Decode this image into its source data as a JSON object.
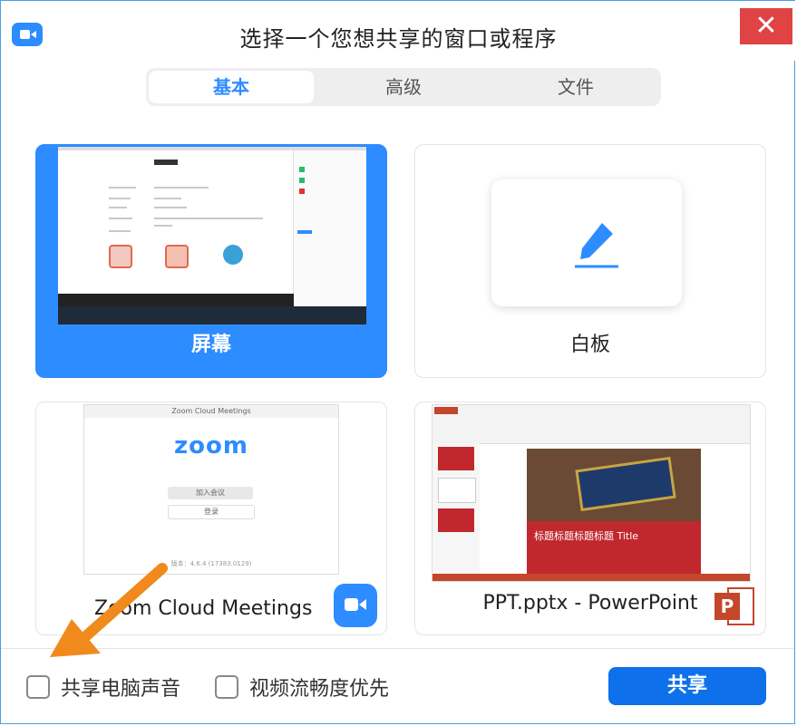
{
  "window": {
    "title": "选择一个您想共享的窗口或程序",
    "close_glyph": "✕"
  },
  "tabs": [
    {
      "label": "基本",
      "active": true
    },
    {
      "label": "高级",
      "active": false
    },
    {
      "label": "文件",
      "active": false
    }
  ],
  "cards": [
    {
      "label": "屏幕",
      "selected": true
    },
    {
      "label": "白板",
      "selected": false
    },
    {
      "label": "Zoom Cloud Meetings",
      "selected": false
    },
    {
      "label": "PPT.pptx - PowerPoint",
      "selected": false
    }
  ],
  "zoom_thumb": {
    "window_title": "Zoom Cloud Meetings",
    "logo": "zoom",
    "join_button": "加入会议",
    "login_button": "登录",
    "footer": "版本：4.6.4 (17383.0129)"
  },
  "ppt_thumb": {
    "slide_title": "标题标题标题标题 Title"
  },
  "options": {
    "share_audio": "共享电脑声音",
    "optimize_video": "视频流畅度优先"
  },
  "share_button": "共享",
  "colors": {
    "accent": "#2d8cff",
    "close": "#e04343",
    "arrow": "#f08a1c",
    "ppt": "#c4462b"
  }
}
